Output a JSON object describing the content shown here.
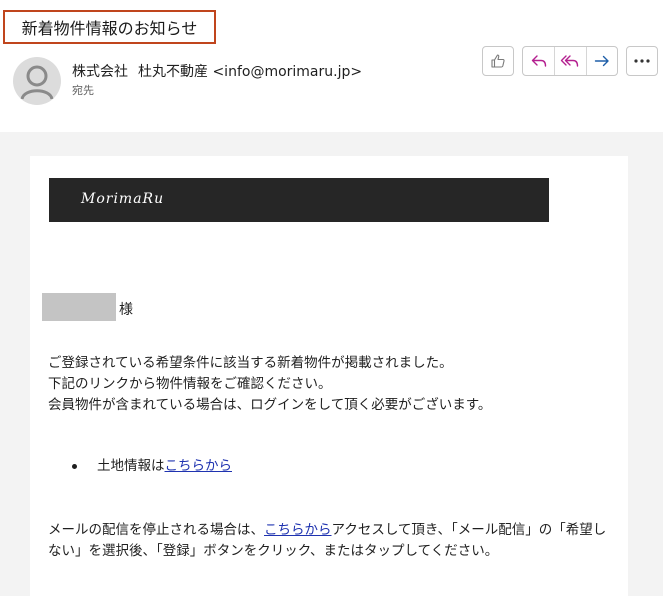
{
  "email": {
    "subject": "新着物件情報のお知らせ",
    "sender_company": "株式会社",
    "sender_name": "杜丸不動産",
    "sender_email": "<info@morimaru.jp>",
    "recipient_label": "宛先"
  },
  "toolbar": {
    "like_icon": "thumbs-up-icon",
    "reply_icon": "reply-icon",
    "reply_all_icon": "reply-all-icon",
    "forward_icon": "forward-icon",
    "more_icon": "more-options-icon"
  },
  "body": {
    "logo_text": "MorimaRu",
    "honorific": "様",
    "intro_lines": [
      "ご登録されている希望条件に該当する新着物件が掲載されました。",
      "下記のリンクから物件情報をご確認ください。",
      "会員物件が含まれている場合は、ログインをして頂く必要がございます。"
    ],
    "bullet": {
      "text": "土地情報は",
      "link": "こちらから"
    },
    "footer": {
      "before": "メールの配信を停止される場合は、",
      "link": "こちらから",
      "after": "アクセスして頂き、「メール配信」の「希望しない」を選択後、「登録」ボタンをクリック、またはタップしてください。"
    }
  },
  "colors": {
    "subject_border": "#c0451d",
    "reply_icon": "#b4208f",
    "forward_icon": "#1f5fa8",
    "link": "#1f33b0",
    "banner": "#262626"
  }
}
